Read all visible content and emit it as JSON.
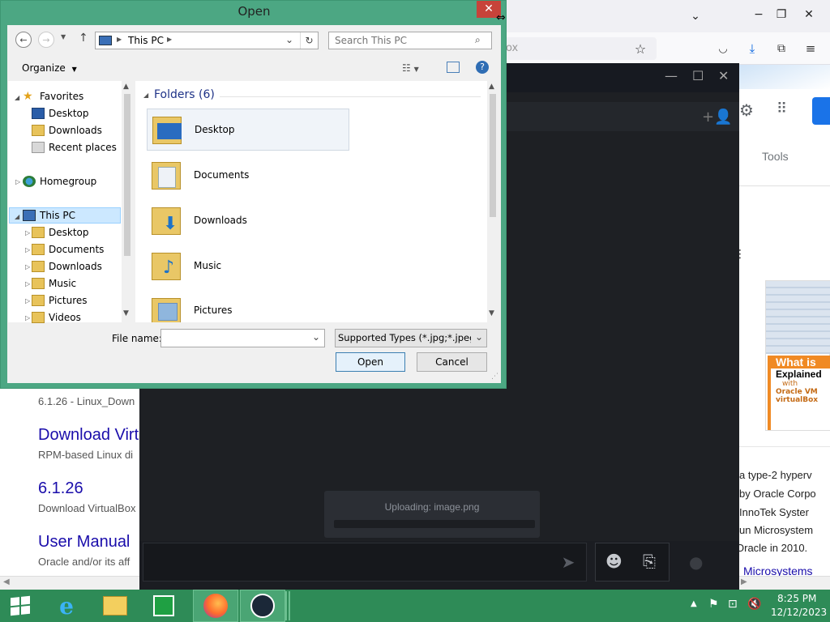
{
  "dialog": {
    "title": "Open",
    "close_label": "✕",
    "address": {
      "root": "This PC"
    },
    "search": {
      "placeholder": "Search This PC"
    },
    "toolbar": {
      "organize_label": "Organize"
    },
    "nav": {
      "favorites_label": "Favorites",
      "favorites": [
        "Desktop",
        "Downloads",
        "Recent places"
      ],
      "homegroup_label": "Homegroup",
      "thispc_label": "This PC",
      "thispc_items": [
        "Desktop",
        "Documents",
        "Downloads",
        "Music",
        "Pictures",
        "Videos"
      ]
    },
    "content": {
      "group_header": "Folders (6)",
      "folders": [
        "Desktop",
        "Documents",
        "Downloads",
        "Music",
        "Pictures"
      ]
    },
    "filename": {
      "label": "File name:",
      "value": ""
    },
    "filetype": {
      "selected": "Supported Types (*.jpg;*.jpeg;*"
    },
    "open_label": "Open",
    "cancel_label": "Cancel"
  },
  "browser": {
    "address_fragment": "ox",
    "tools_label": "Tools"
  },
  "page": {
    "line1": "6.1.26 - Linux_Down",
    "link1": "Download Virt",
    "text1": "RPM-based Linux di",
    "link2": "6.1.26",
    "text2": "Download VirtualBox",
    "link3": "User Manual",
    "text3": "Oracle and/or its aff",
    "right_lines": [
      "a type-2 hyperv",
      "by Oracle Corpo",
      "InnoTek Syster",
      "un Microsystem",
      "Oracle in 2010."
    ],
    "right_link": "Microsystems",
    "thumb_title": "What is",
    "thumb_sub": "Explained",
    "thumb_with": "with",
    "thumb_brand1": "Oracle VM",
    "thumb_brand2": "virtualBox"
  },
  "steam": {
    "upload_text": "Uploading: image.png"
  },
  "taskbar": {
    "time": "8:25 PM",
    "date": "12/12/2023"
  },
  "colors": {
    "dialog_frame": "#4ca783",
    "taskbar": "#2e8b57",
    "close_button": "#c7433a",
    "steam_bg": "#1e2024",
    "link": "#1a0dab"
  }
}
